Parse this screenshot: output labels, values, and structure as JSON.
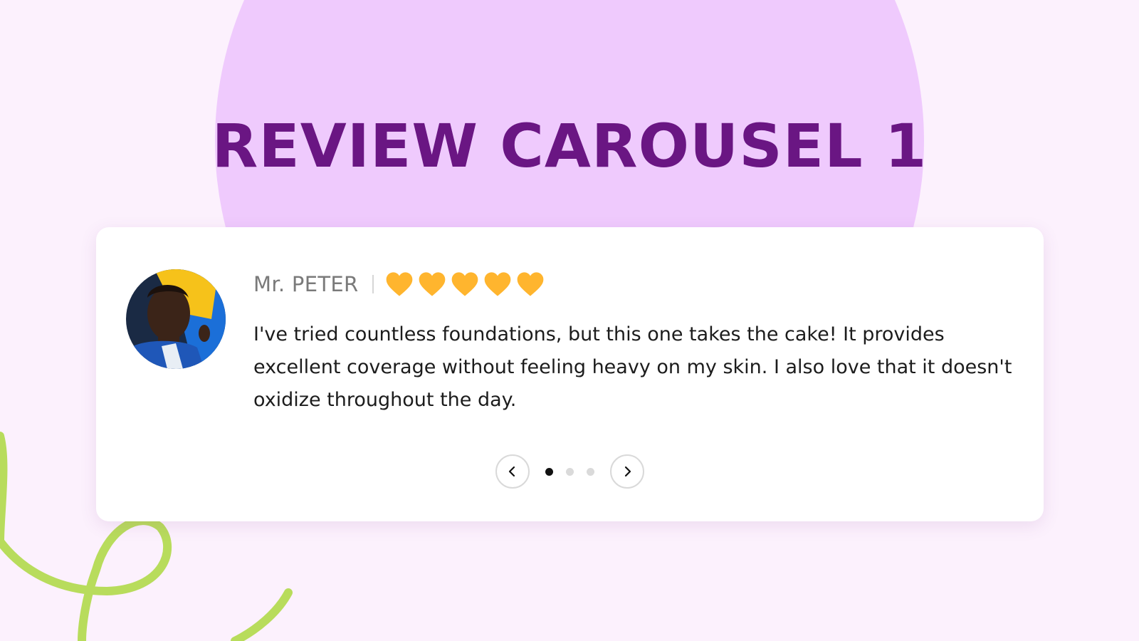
{
  "page": {
    "title": "REVIEW CAROUSEL 1"
  },
  "colors": {
    "background": "#fcf1fd",
    "circle": "#efcafd",
    "title": "#6a1683",
    "heart": "#ffb52e",
    "squiggle": "#b8dc5c"
  },
  "review": {
    "reviewer_name": "Mr. PETER",
    "rating": 5,
    "rating_max": 5,
    "rating_icon": "heart-icon",
    "text": "I've tried countless foundations, but this one takes the cake! It provides excellent coverage without feeling heavy on my skin. I also love that it doesn't oxidize throughout the day."
  },
  "carousel": {
    "slide_count": 3,
    "active_index": 0,
    "prev_icon": "chevron-left-icon",
    "next_icon": "chevron-right-icon"
  }
}
